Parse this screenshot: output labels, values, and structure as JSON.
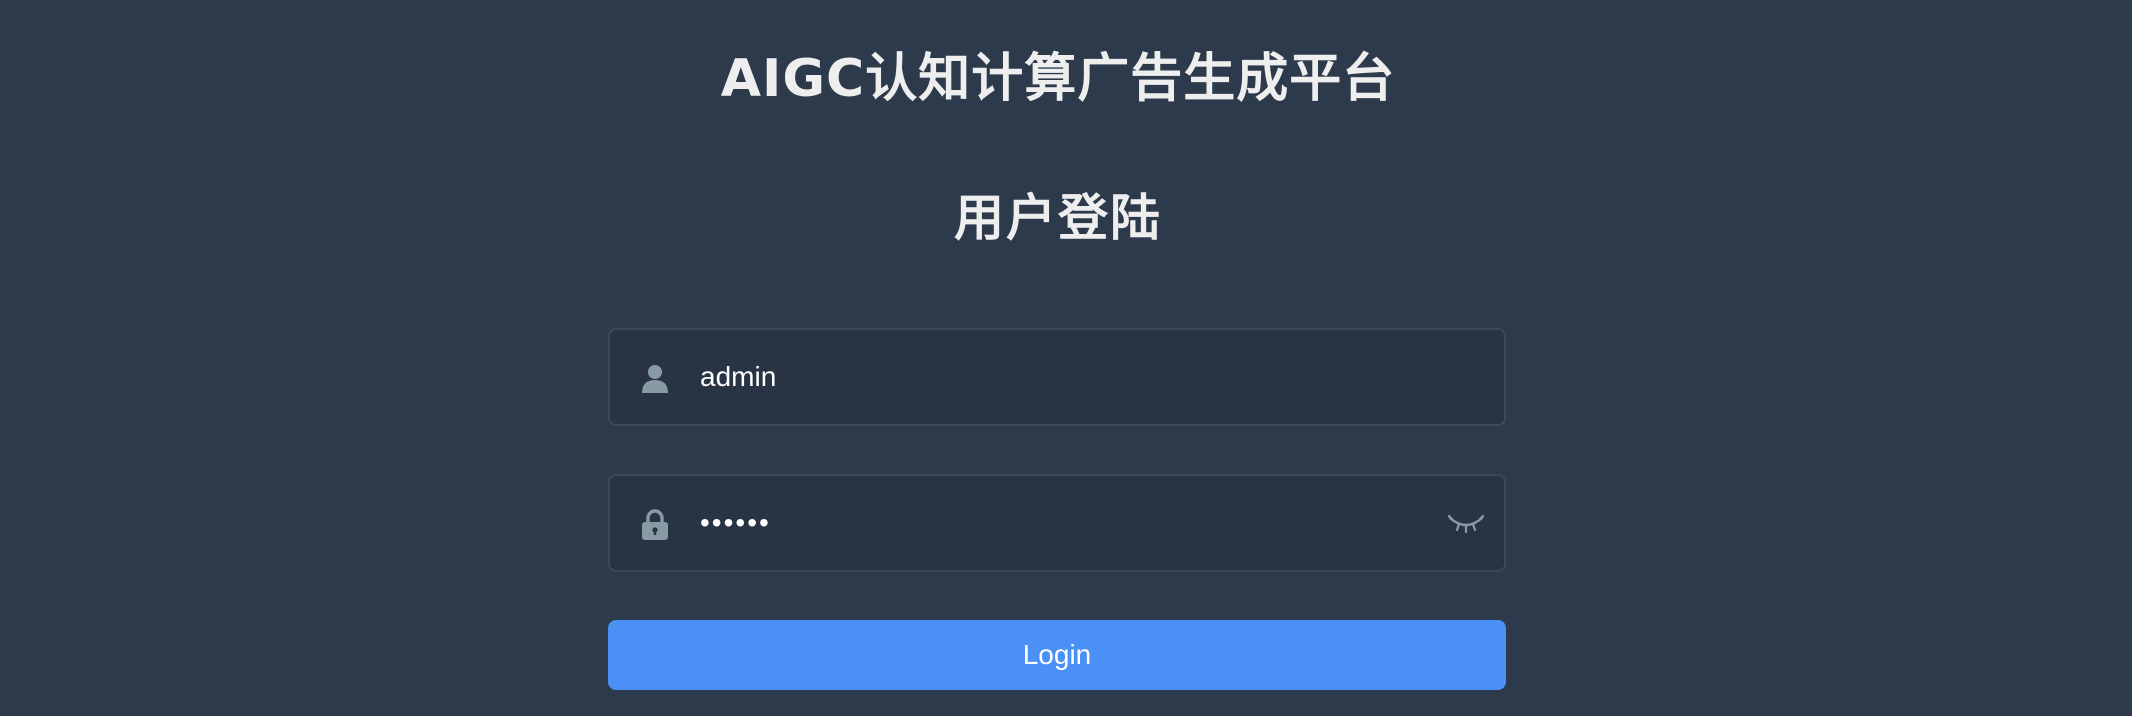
{
  "app": {
    "title": "AIGC认知计算广告生成平台",
    "subtitle": "用户登陆"
  },
  "form": {
    "username": {
      "value": "admin",
      "icon": "user-icon"
    },
    "password": {
      "value": "111111",
      "icon": "lock-icon",
      "toggle_icon": "eye-closed-icon"
    },
    "login_label": "Login"
  },
  "colors": {
    "background": "#2d3a4b",
    "input_background": "#283443",
    "button": "#4a90f5",
    "icon": "#889aa4",
    "text": "#eeeeee"
  }
}
